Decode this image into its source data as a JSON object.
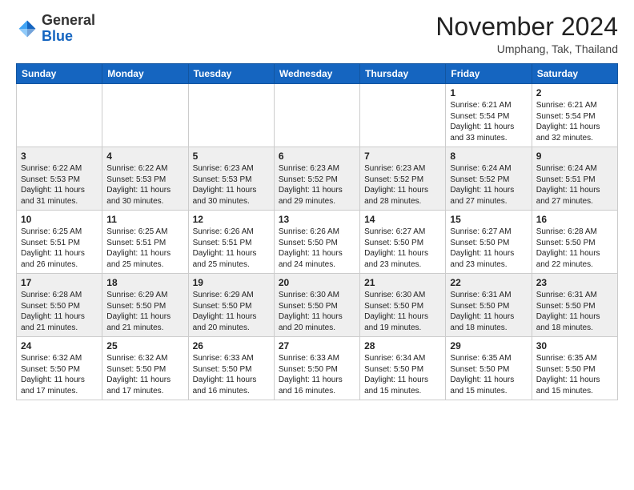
{
  "logo": {
    "general": "General",
    "blue": "Blue"
  },
  "header": {
    "month": "November 2024",
    "location": "Umphang, Tak, Thailand"
  },
  "weekdays": [
    "Sunday",
    "Monday",
    "Tuesday",
    "Wednesday",
    "Thursday",
    "Friday",
    "Saturday"
  ],
  "weeks": [
    [
      {
        "day": "",
        "info": ""
      },
      {
        "day": "",
        "info": ""
      },
      {
        "day": "",
        "info": ""
      },
      {
        "day": "",
        "info": ""
      },
      {
        "day": "",
        "info": ""
      },
      {
        "day": "1",
        "info": "Sunrise: 6:21 AM\nSunset: 5:54 PM\nDaylight: 11 hours\nand 33 minutes."
      },
      {
        "day": "2",
        "info": "Sunrise: 6:21 AM\nSunset: 5:54 PM\nDaylight: 11 hours\nand 32 minutes."
      }
    ],
    [
      {
        "day": "3",
        "info": "Sunrise: 6:22 AM\nSunset: 5:53 PM\nDaylight: 11 hours\nand 31 minutes."
      },
      {
        "day": "4",
        "info": "Sunrise: 6:22 AM\nSunset: 5:53 PM\nDaylight: 11 hours\nand 30 minutes."
      },
      {
        "day": "5",
        "info": "Sunrise: 6:23 AM\nSunset: 5:53 PM\nDaylight: 11 hours\nand 30 minutes."
      },
      {
        "day": "6",
        "info": "Sunrise: 6:23 AM\nSunset: 5:52 PM\nDaylight: 11 hours\nand 29 minutes."
      },
      {
        "day": "7",
        "info": "Sunrise: 6:23 AM\nSunset: 5:52 PM\nDaylight: 11 hours\nand 28 minutes."
      },
      {
        "day": "8",
        "info": "Sunrise: 6:24 AM\nSunset: 5:52 PM\nDaylight: 11 hours\nand 27 minutes."
      },
      {
        "day": "9",
        "info": "Sunrise: 6:24 AM\nSunset: 5:51 PM\nDaylight: 11 hours\nand 27 minutes."
      }
    ],
    [
      {
        "day": "10",
        "info": "Sunrise: 6:25 AM\nSunset: 5:51 PM\nDaylight: 11 hours\nand 26 minutes."
      },
      {
        "day": "11",
        "info": "Sunrise: 6:25 AM\nSunset: 5:51 PM\nDaylight: 11 hours\nand 25 minutes."
      },
      {
        "day": "12",
        "info": "Sunrise: 6:26 AM\nSunset: 5:51 PM\nDaylight: 11 hours\nand 25 minutes."
      },
      {
        "day": "13",
        "info": "Sunrise: 6:26 AM\nSunset: 5:50 PM\nDaylight: 11 hours\nand 24 minutes."
      },
      {
        "day": "14",
        "info": "Sunrise: 6:27 AM\nSunset: 5:50 PM\nDaylight: 11 hours\nand 23 minutes."
      },
      {
        "day": "15",
        "info": "Sunrise: 6:27 AM\nSunset: 5:50 PM\nDaylight: 11 hours\nand 23 minutes."
      },
      {
        "day": "16",
        "info": "Sunrise: 6:28 AM\nSunset: 5:50 PM\nDaylight: 11 hours\nand 22 minutes."
      }
    ],
    [
      {
        "day": "17",
        "info": "Sunrise: 6:28 AM\nSunset: 5:50 PM\nDaylight: 11 hours\nand 21 minutes."
      },
      {
        "day": "18",
        "info": "Sunrise: 6:29 AM\nSunset: 5:50 PM\nDaylight: 11 hours\nand 21 minutes."
      },
      {
        "day": "19",
        "info": "Sunrise: 6:29 AM\nSunset: 5:50 PM\nDaylight: 11 hours\nand 20 minutes."
      },
      {
        "day": "20",
        "info": "Sunrise: 6:30 AM\nSunset: 5:50 PM\nDaylight: 11 hours\nand 20 minutes."
      },
      {
        "day": "21",
        "info": "Sunrise: 6:30 AM\nSunset: 5:50 PM\nDaylight: 11 hours\nand 19 minutes."
      },
      {
        "day": "22",
        "info": "Sunrise: 6:31 AM\nSunset: 5:50 PM\nDaylight: 11 hours\nand 18 minutes."
      },
      {
        "day": "23",
        "info": "Sunrise: 6:31 AM\nSunset: 5:50 PM\nDaylight: 11 hours\nand 18 minutes."
      }
    ],
    [
      {
        "day": "24",
        "info": "Sunrise: 6:32 AM\nSunset: 5:50 PM\nDaylight: 11 hours\nand 17 minutes."
      },
      {
        "day": "25",
        "info": "Sunrise: 6:32 AM\nSunset: 5:50 PM\nDaylight: 11 hours\nand 17 minutes."
      },
      {
        "day": "26",
        "info": "Sunrise: 6:33 AM\nSunset: 5:50 PM\nDaylight: 11 hours\nand 16 minutes."
      },
      {
        "day": "27",
        "info": "Sunrise: 6:33 AM\nSunset: 5:50 PM\nDaylight: 11 hours\nand 16 minutes."
      },
      {
        "day": "28",
        "info": "Sunrise: 6:34 AM\nSunset: 5:50 PM\nDaylight: 11 hours\nand 15 minutes."
      },
      {
        "day": "29",
        "info": "Sunrise: 6:35 AM\nSunset: 5:50 PM\nDaylight: 11 hours\nand 15 minutes."
      },
      {
        "day": "30",
        "info": "Sunrise: 6:35 AM\nSunset: 5:50 PM\nDaylight: 11 hours\nand 15 minutes."
      }
    ]
  ]
}
